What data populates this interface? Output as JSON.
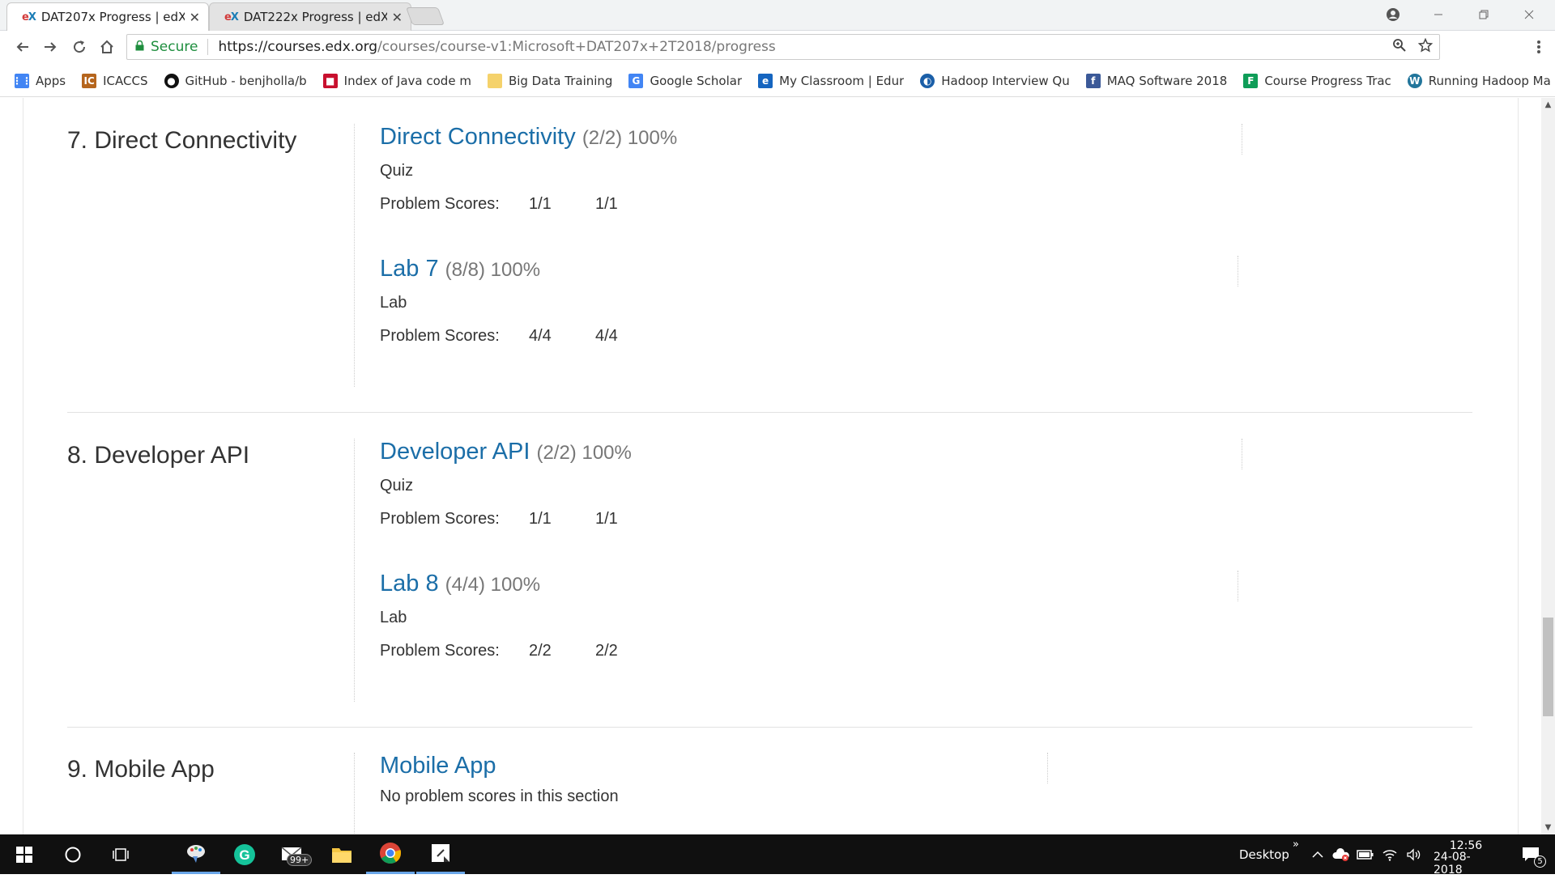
{
  "browser": {
    "tabs": [
      {
        "title": "DAT207x Progress | edX",
        "active": true
      },
      {
        "title": "DAT222x Progress | edX",
        "active": false
      }
    ],
    "favicon_e": "e",
    "favicon_x": "X",
    "close_glyph": "✕",
    "url_secure_label": "Secure",
    "url_base": "https://courses.edx.org",
    "url_path": "/courses/course-v1:Microsoft+DAT207x+2T2018/progress",
    "bookmarks": [
      {
        "label": "Apps",
        "icon": "apps-grid-icon",
        "color": "#4285f4"
      },
      {
        "label": "ICACCS",
        "icon": "icaccs-icon",
        "color": "#b5651d"
      },
      {
        "label": "GitHub - benjholla/b",
        "icon": "github-icon",
        "color": "#111111"
      },
      {
        "label": "Index of Java code m",
        "icon": "index-icon",
        "color": "#c8102e"
      },
      {
        "label": "Big Data Training",
        "icon": "folder-icon",
        "color": "#f5d26b"
      },
      {
        "label": "Google Scholar",
        "icon": "scholar-icon",
        "color": "#4285f4"
      },
      {
        "label": "My Classroom | Edur",
        "icon": "edureka-icon",
        "color": "#1565c0"
      },
      {
        "label": "Hadoop Interview Qu",
        "icon": "hadoop-icon",
        "color": "#1b5fa8"
      },
      {
        "label": "MAQ Software 2018",
        "icon": "facebook-icon",
        "color": "#3b5998"
      },
      {
        "label": "Course Progress Trac",
        "icon": "sheets-icon",
        "color": "#0f9d58"
      },
      {
        "label": "Running Hadoop Ma",
        "icon": "wordpress-icon",
        "color": "#21759b"
      }
    ]
  },
  "progress": {
    "chapters": [
      {
        "title": "7. Direct Connectivity",
        "sections": [
          {
            "name": "Direct Connectivity",
            "score": "(2/2) 100%",
            "type": "Quiz",
            "scores_label": "Problem Scores:",
            "scores": [
              "1/1",
              "1/1"
            ]
          },
          {
            "name": "Lab 7",
            "score": "(8/8) 100%",
            "type": "Lab",
            "scores_label": "Problem Scores:",
            "scores": [
              "4/4",
              "4/4"
            ]
          }
        ]
      },
      {
        "title": "8. Developer API",
        "sections": [
          {
            "name": "Developer API",
            "score": "(2/2) 100%",
            "type": "Quiz",
            "scores_label": "Problem Scores:",
            "scores": [
              "1/1",
              "1/1"
            ]
          },
          {
            "name": "Lab 8",
            "score": "(4/4) 100%",
            "type": "Lab",
            "scores_label": "Problem Scores:",
            "scores": [
              "2/2",
              "2/2"
            ]
          }
        ]
      },
      {
        "title": "9. Mobile App",
        "sections": [
          {
            "name": "Mobile App",
            "score": "",
            "type": "No problem scores in this section"
          }
        ]
      }
    ]
  },
  "taskbar": {
    "mail_badge": "99+",
    "desktop_label": "Desktop",
    "chevron": "»",
    "time": "12:56",
    "date": "24-08-2018",
    "notification_count": "5"
  },
  "colors": {
    "link": "#1b6ea8",
    "secure": "#1e8e3e",
    "taskbar": "#101010"
  }
}
